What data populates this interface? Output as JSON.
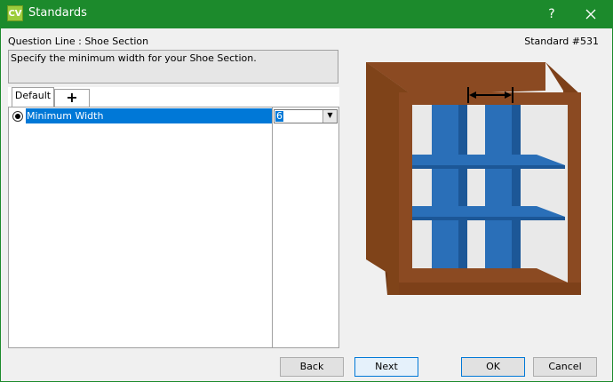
{
  "window": {
    "app_icon_text": "CV",
    "title": "Standards",
    "help_glyph": "?"
  },
  "header": {
    "question_line": "Question Line : Shoe Section",
    "standard_number": "Standard #531",
    "description": "Specify the minimum width for your Shoe Section."
  },
  "tabs": [
    {
      "label": "Default"
    },
    {
      "label": "+"
    }
  ],
  "list": {
    "items": [
      {
        "label": "Minimum Width",
        "value": "6",
        "selected": true
      }
    ]
  },
  "buttons": {
    "back": "Back",
    "next": "Next",
    "ok": "OK",
    "cancel": "Cancel"
  },
  "colors": {
    "titlebar": "#1c8a2c",
    "selection": "#0078d7",
    "cabinet_wood": "#8b4a22",
    "shelf_blue": "#2a6fb8"
  },
  "illustration": {
    "icon": "shoe-section-cabinet-diagram"
  }
}
